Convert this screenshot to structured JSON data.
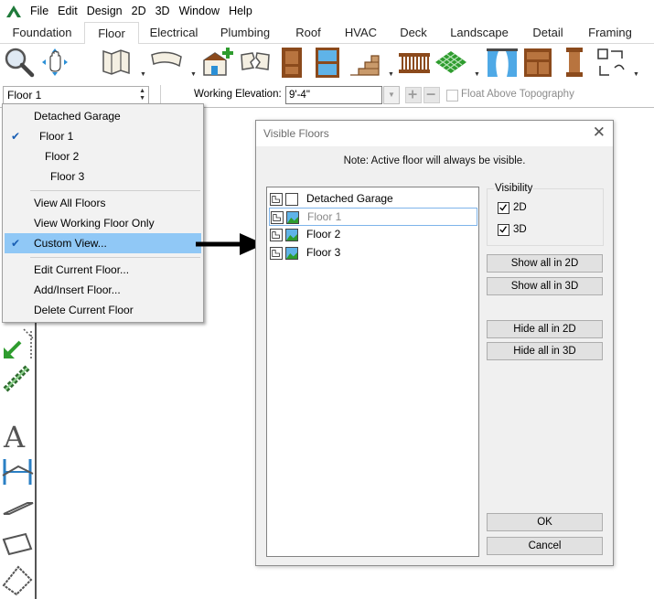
{
  "menubar": {
    "items": [
      "File",
      "Edit",
      "Design",
      "2D",
      "3D",
      "Window",
      "Help"
    ]
  },
  "tabs": [
    {
      "label": "Foundation",
      "active": false
    },
    {
      "label": "Floor",
      "active": true
    },
    {
      "label": "Electrical",
      "active": false
    },
    {
      "label": "Plumbing",
      "active": false
    },
    {
      "label": "Roof",
      "active": false
    },
    {
      "label": "HVAC",
      "active": false
    },
    {
      "label": "Deck",
      "active": false
    },
    {
      "label": "Landscape",
      "active": false
    },
    {
      "label": "Detail",
      "active": false
    },
    {
      "label": "Framing",
      "active": false
    }
  ],
  "toolbar": {
    "icons": [
      "magnifier-icon",
      "pan-hand-icon",
      "floor-plan-icon",
      "curved-wall-icon",
      "add-room-icon",
      "broken-wall-icon",
      "door-icon",
      "window-icon",
      "stairs-icon",
      "railing-icon",
      "floor-tile-icon",
      "curtain-icon",
      "cabinet-icon",
      "column-icon",
      "shapes-icon"
    ]
  },
  "options_bar": {
    "floor_selector_value": "Floor 1",
    "working_elevation_label": "Working Elevation:",
    "working_elevation_value": "9'-4\"",
    "float_above_label": "Float Above Topography"
  },
  "floor_menu": {
    "floors": [
      {
        "label": "Detached Garage",
        "checked": false
      },
      {
        "label": "Floor 1",
        "checked": true
      },
      {
        "label": "Floor 2",
        "checked": false
      },
      {
        "label": "Floor 3",
        "checked": false
      }
    ],
    "views": [
      {
        "label": "View All Floors",
        "checked": false
      },
      {
        "label": "View Working Floor Only",
        "checked": false
      },
      {
        "label": "Custom View...",
        "checked": true
      }
    ],
    "actions": [
      {
        "label": "Edit Current Floor..."
      },
      {
        "label": "Add/Insert Floor..."
      },
      {
        "label": "Delete Current Floor"
      }
    ]
  },
  "dialog": {
    "title": "Visible Floors",
    "note": "Note: Active floor will always be visible.",
    "floors": [
      {
        "label": "Detached Garage",
        "visible_3d": false,
        "active": false
      },
      {
        "label": "Floor 1",
        "visible_3d": true,
        "active": true
      },
      {
        "label": "Floor 2",
        "visible_3d": true,
        "active": false
      },
      {
        "label": "Floor 3",
        "visible_3d": true,
        "active": false
      }
    ],
    "visibility": {
      "title": "Visibility",
      "label_2d": "2D",
      "label_3d": "3D",
      "checked_2d": true,
      "checked_3d": true
    },
    "buttons": {
      "show_all_2d": "Show all in 2D",
      "show_all_3d": "Show all in 3D",
      "hide_all_2d": "Hide all in 2D",
      "hide_all_3d": "Hide all in 3D",
      "ok": "OK",
      "cancel": "Cancel"
    }
  },
  "colors": {
    "menu_highlight": "#90c8f6",
    "checkmark": "#1a5fb4",
    "selection_border": "#7eb4ea",
    "icon_brown": "#8b4a1c",
    "icon_blue": "#2a8fd6",
    "icon_green": "#2e9c2e"
  }
}
